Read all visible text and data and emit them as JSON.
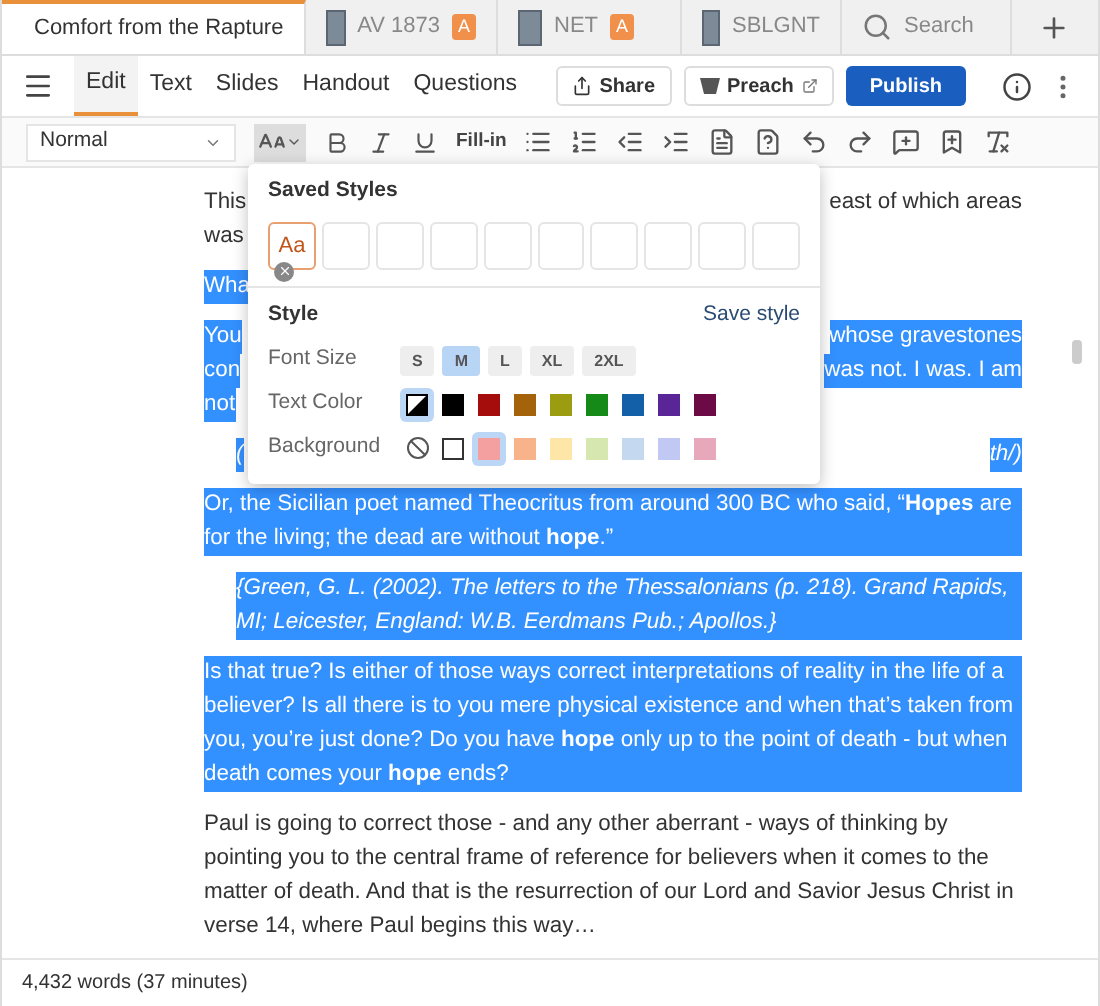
{
  "tabs": [
    {
      "kind": "document",
      "label": "Comfort from the Rapture",
      "selected": true
    },
    {
      "kind": "resource",
      "label": "AV 1873",
      "badge": "A",
      "selected": false
    },
    {
      "kind": "resource",
      "label": "NET",
      "badge": "A",
      "selected": false
    },
    {
      "kind": "resource",
      "label": "SBLGNT",
      "selected": false
    },
    {
      "kind": "search",
      "label": "Search",
      "selected": false
    }
  ],
  "menu_tabs": [
    {
      "label": "Edit",
      "selected": true
    },
    {
      "label": "Text",
      "selected": false
    },
    {
      "label": "Slides",
      "selected": false
    },
    {
      "label": "Handout",
      "selected": false
    },
    {
      "label": "Questions",
      "selected": false
    }
  ],
  "actions": {
    "share": "Share",
    "preach": "Preach",
    "publish": "Publish"
  },
  "format_toolbar": {
    "style_select": "Normal",
    "fill_in": "Fill-in"
  },
  "popup": {
    "saved_title": "Saved Styles",
    "saved_slots": [
      {
        "filled": true,
        "sample": "Aa"
      },
      {
        "filled": false
      },
      {
        "filled": false
      },
      {
        "filled": false
      },
      {
        "filled": false
      },
      {
        "filled": false
      },
      {
        "filled": false
      },
      {
        "filled": false
      },
      {
        "filled": false
      },
      {
        "filled": false
      }
    ],
    "style_title": "Style",
    "save_link": "Save style",
    "font_size": {
      "label": "Font Size",
      "options": [
        {
          "label": "S",
          "selected": false
        },
        {
          "label": "M",
          "selected": true
        },
        {
          "label": "L",
          "selected": false
        },
        {
          "label": "XL",
          "selected": false
        },
        {
          "label": "2XL",
          "selected": false
        }
      ]
    },
    "text_color": {
      "label": "Text Color",
      "swatches": [
        {
          "kind": "auto",
          "selected": true
        },
        {
          "kind": "color",
          "color": "#000000",
          "selected": false
        },
        {
          "kind": "color",
          "color": "#a50d0d",
          "selected": false
        },
        {
          "kind": "color",
          "color": "#a4620a",
          "selected": false
        },
        {
          "kind": "color",
          "color": "#9c9c10",
          "selected": false
        },
        {
          "kind": "color",
          "color": "#158a18",
          "selected": false
        },
        {
          "kind": "color",
          "color": "#1460a8",
          "selected": false
        },
        {
          "kind": "color",
          "color": "#5a2596",
          "selected": false
        },
        {
          "kind": "color",
          "color": "#6b0a45",
          "selected": false
        }
      ]
    },
    "background": {
      "label": "Background",
      "swatches": [
        {
          "kind": "none",
          "selected": false
        },
        {
          "kind": "outline",
          "color": "#ffffff",
          "selected": false
        },
        {
          "kind": "color",
          "color": "#f4a0a0",
          "selected": true
        },
        {
          "kind": "color",
          "color": "#f9b38a",
          "selected": false
        },
        {
          "kind": "color",
          "color": "#fde6a8",
          "selected": false
        },
        {
          "kind": "color",
          "color": "#d6e8b0",
          "selected": false
        },
        {
          "kind": "color",
          "color": "#c4d8ef",
          "selected": false
        },
        {
          "kind": "color",
          "color": "#c2c8f4",
          "selected": false
        },
        {
          "kind": "color",
          "color": "#e8a8bc",
          "selected": false
        }
      ]
    }
  },
  "document": [
    {
      "kind": "partial",
      "selected": false,
      "citation": false,
      "lines": [
        {
          "left": "This",
          "right": "east of which areas"
        },
        {
          "left": "was"
        }
      ]
    },
    {
      "kind": "partial",
      "selected": true,
      "citation": false,
      "lines": [
        {
          "left": "Wha"
        }
      ]
    },
    {
      "kind": "partial",
      "selected": true,
      "citation": false,
      "lines": [
        {
          "left": "You",
          "right": "whose gravestones"
        },
        {
          "left": "con",
          "right": "was not. I was. I am"
        },
        {
          "left": "not"
        }
      ]
    },
    {
      "kind": "partial",
      "selected": true,
      "citation": true,
      "lines": [
        {
          "left": "(",
          "right": "th/)"
        }
      ]
    },
    {
      "kind": "paragraph",
      "selected": true,
      "citation": false,
      "text": "Or, the Sicilian poet named Theocritus from around 300 BC who said, “**Hopes** are for the living; the dead are without **hope**.”"
    },
    {
      "kind": "paragraph",
      "selected": true,
      "citation": true,
      "text": "{Green, G. L. (2002). The letters to the Thessalonians (p. 218). Grand Rapids, MI; Leicester, England: W.B. Eerdmans Pub.; Apollos.}"
    },
    {
      "kind": "paragraph",
      "selected": true,
      "citation": false,
      "text": "Is that true? Is either of those ways correct interpretations of reality in the life of a believer? Is all there is to you mere physical existence and when that’s taken from you, you’re just done? Do you have **hope** only up to the point of death - but when death comes your **hope** ends?"
    },
    {
      "kind": "paragraph",
      "selected": false,
      "citation": false,
      "text": "Paul is going to correct those - and any other aberrant - ways of thinking by pointing you to the central frame of reference for believers when it comes to the matter of death. And that is the resurrection of our Lord and Savior Jesus Christ in verse 14, where Paul begins this way…"
    }
  ],
  "status_bar": "4,432 words (37 minutes)"
}
